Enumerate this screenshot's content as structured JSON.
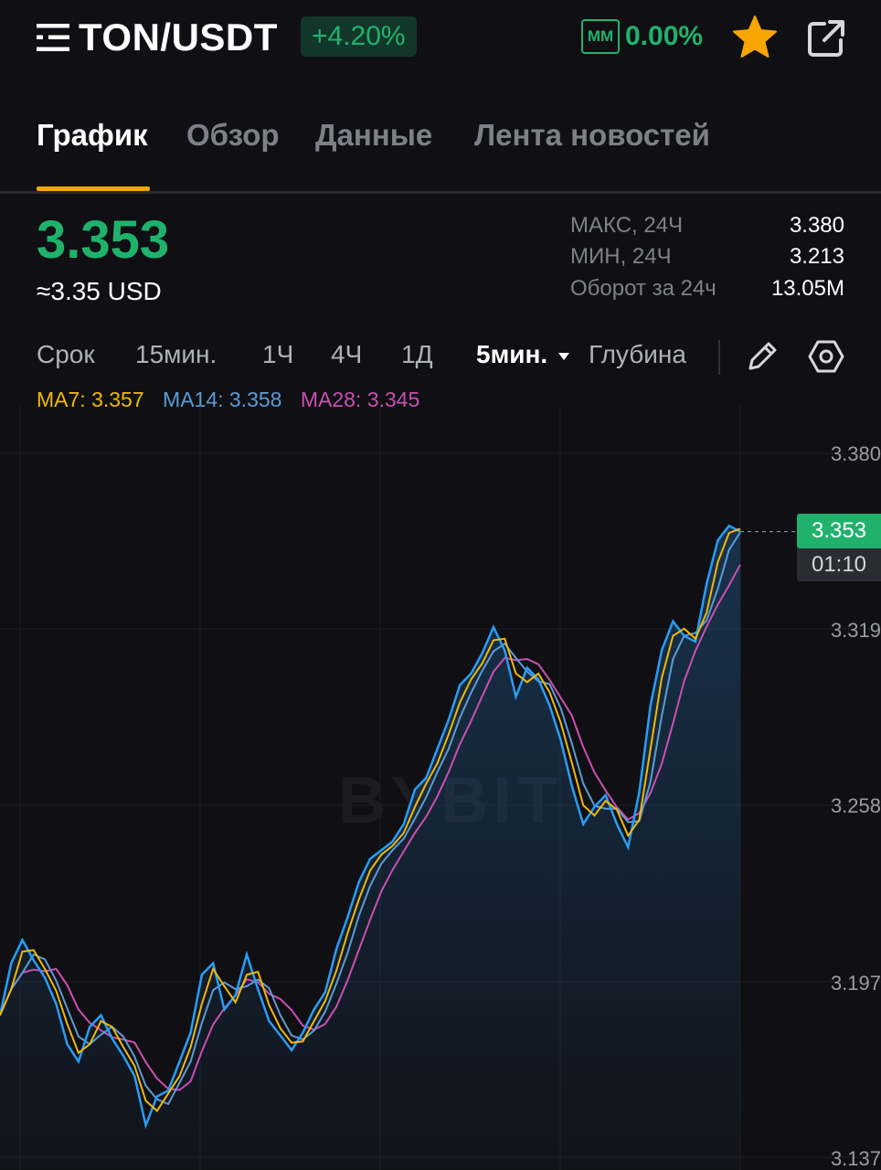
{
  "header": {
    "pair": "TON/USDT",
    "change": "+4.20%",
    "mm_label": "MM",
    "mm_value": "0.00%"
  },
  "tabs": [
    {
      "label": "График",
      "active": true
    },
    {
      "label": "Обзор",
      "active": false
    },
    {
      "label": "Данные",
      "active": false
    },
    {
      "label": "Лента новостей",
      "active": false
    }
  ],
  "ticker": {
    "price": "3.353",
    "usd_value": "≈3.35 USD",
    "stats": [
      {
        "label": "МАКС, 24Ч",
        "value": "3.380"
      },
      {
        "label": "МИН, 24Ч",
        "value": "3.213"
      },
      {
        "label": "Оборот за 24ч",
        "value": "13.05M"
      }
    ]
  },
  "timeframes": {
    "items": [
      "Срок",
      "15мин.",
      "1Ч",
      "4Ч",
      "1Д",
      "5мин.",
      "Глубина"
    ],
    "active": "5мин."
  },
  "ma": [
    {
      "label": "MA7: 3.357",
      "color": "#f0b90b"
    },
    {
      "label": "MA14: 3.358",
      "color": "#5b9bd5"
    },
    {
      "label": "MA28: 3.345",
      "color": "#c94fb0"
    }
  ],
  "colors": {
    "up": "#20b26c",
    "accent": "#f7a600",
    "price_line": "#2a9df4"
  },
  "chart_data": {
    "type": "area",
    "watermark": "BYBIT",
    "ylim": [
      3.137,
      3.38
    ],
    "y_ticks": [
      "3.380",
      "3.319",
      "3.258",
      "3.197",
      "3.137"
    ],
    "last_price_tag": "3.353",
    "countdown": "01:10",
    "series": [
      {
        "name": "price",
        "values": [
          3.186,
          3.204,
          3.212,
          3.205,
          3.199,
          3.19,
          3.176,
          3.17,
          3.182,
          3.186,
          3.178,
          3.172,
          3.165,
          3.148,
          3.158,
          3.16,
          3.17,
          3.18,
          3.2,
          3.204,
          3.188,
          3.193,
          3.207,
          3.195,
          3.184,
          3.179,
          3.174,
          3.18,
          3.188,
          3.194,
          3.209,
          3.22,
          3.232,
          3.24,
          3.243,
          3.246,
          3.252,
          3.264,
          3.268,
          3.278,
          3.288,
          3.3,
          3.304,
          3.311,
          3.32,
          3.312,
          3.296,
          3.306,
          3.302,
          3.293,
          3.281,
          3.265,
          3.252,
          3.258,
          3.262,
          3.252,
          3.244,
          3.263,
          3.293,
          3.312,
          3.322,
          3.317,
          3.315,
          3.335,
          3.35,
          3.355,
          3.353
        ]
      }
    ]
  }
}
